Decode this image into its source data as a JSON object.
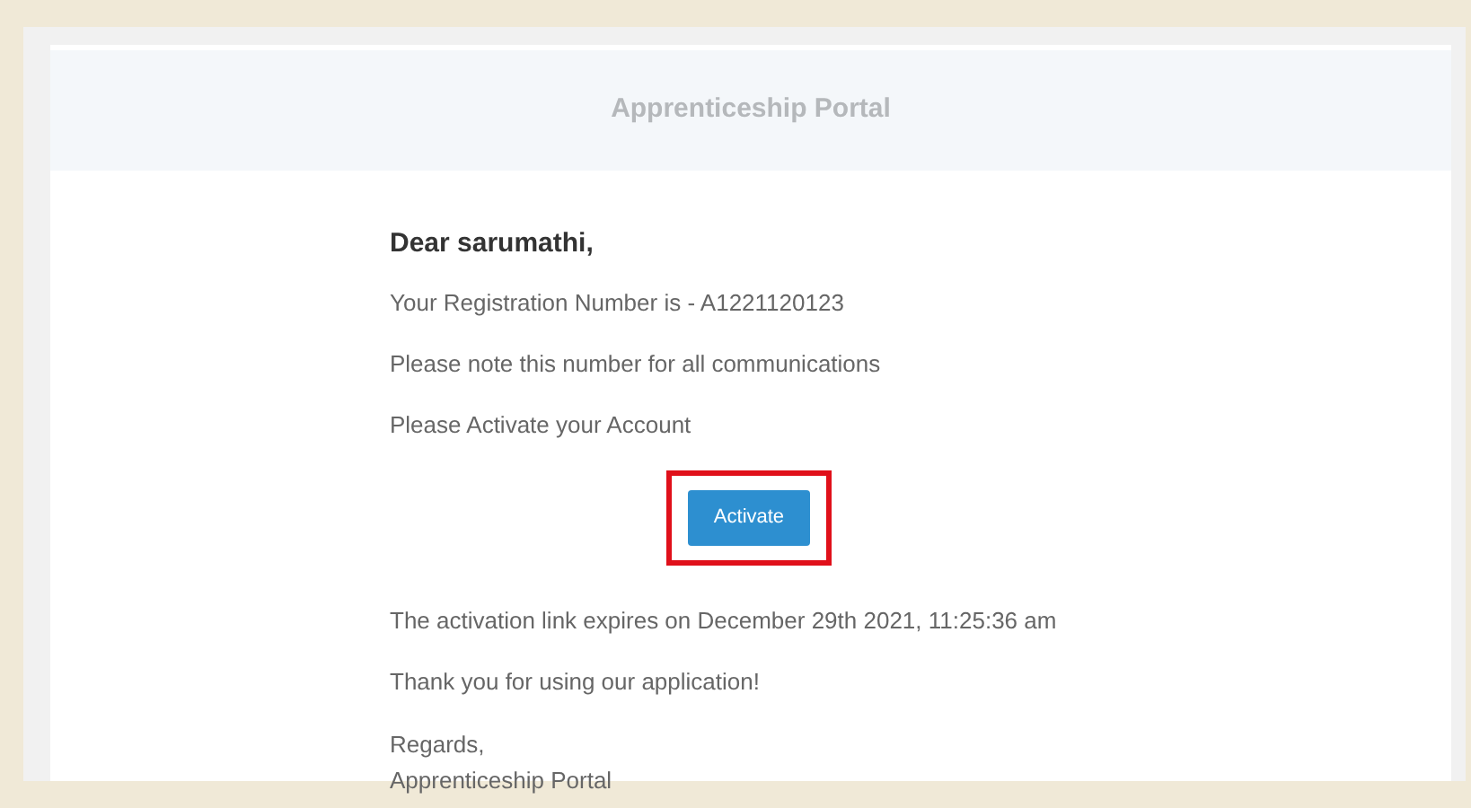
{
  "header": {
    "title": "Apprenticeship Portal"
  },
  "email": {
    "greeting": "Dear sarumathi,",
    "paragraphs": [
      "Your Registration Number is - A1221120123",
      "Please note this number for all communications",
      "Please Activate your Account"
    ],
    "button": {
      "label": "Activate",
      "highlighted": true
    },
    "after": [
      "The activation link expires on December 29th 2021, 11:25:36 am",
      "Thank you for using our application!"
    ],
    "signoff": [
      "Regards,",
      "Apprenticeship Portal"
    ]
  }
}
